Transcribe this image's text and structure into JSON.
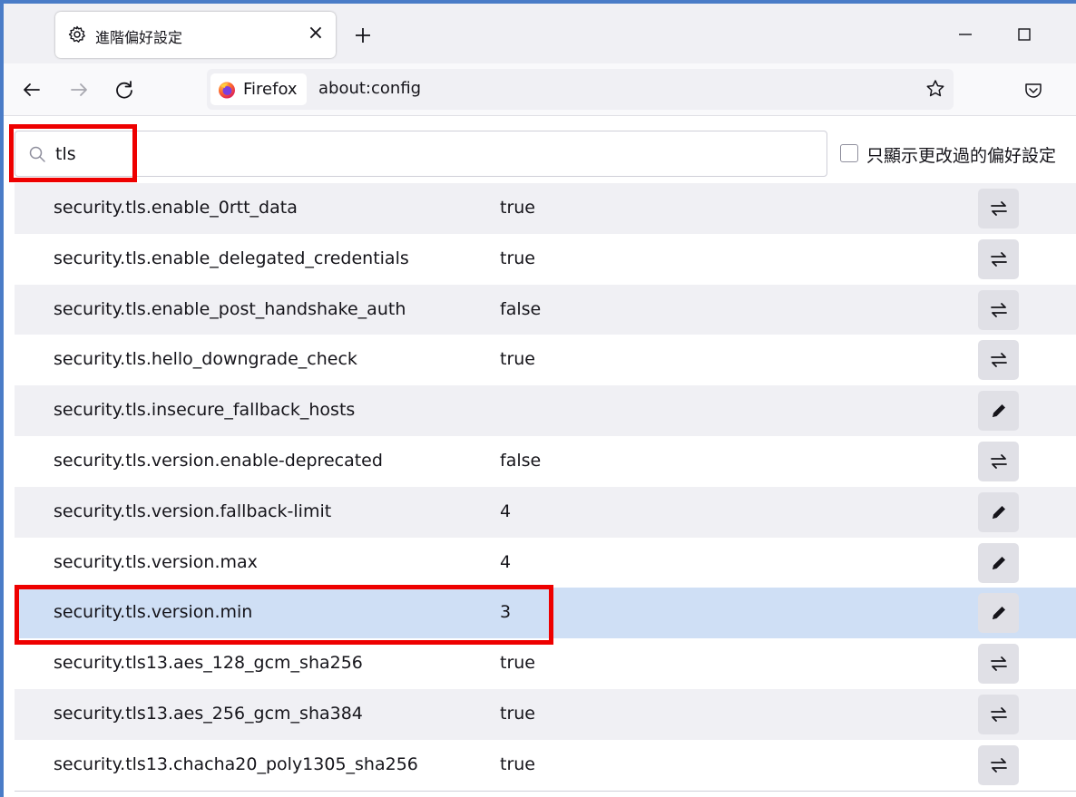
{
  "tab": {
    "title": "進階偏好設定",
    "close_label": "×"
  },
  "urlbar": {
    "identity_label": "Firefox",
    "url": "about:config"
  },
  "search": {
    "value": "tls"
  },
  "filter": {
    "modified_only_label": "只顯示更改過的偏好設定"
  },
  "prefs": [
    {
      "name": "security.tls.enable_0rtt_data",
      "value": "true",
      "action": "toggle"
    },
    {
      "name": "security.tls.enable_delegated_credentials",
      "value": "true",
      "action": "toggle"
    },
    {
      "name": "security.tls.enable_post_handshake_auth",
      "value": "false",
      "action": "toggle"
    },
    {
      "name": "security.tls.hello_downgrade_check",
      "value": "true",
      "action": "toggle"
    },
    {
      "name": "security.tls.insecure_fallback_hosts",
      "value": "",
      "action": "edit"
    },
    {
      "name": "security.tls.version.enable-deprecated",
      "value": "false",
      "action": "toggle"
    },
    {
      "name": "security.tls.version.fallback-limit",
      "value": "4",
      "action": "edit"
    },
    {
      "name": "security.tls.version.max",
      "value": "4",
      "action": "edit"
    },
    {
      "name": "security.tls.version.min",
      "value": "3",
      "action": "edit",
      "selected": true
    },
    {
      "name": "security.tls13.aes_128_gcm_sha256",
      "value": "true",
      "action": "toggle"
    },
    {
      "name": "security.tls13.aes_256_gcm_sha384",
      "value": "true",
      "action": "toggle"
    },
    {
      "name": "security.tls13.chacha20_poly1305_sha256",
      "value": "true",
      "action": "toggle"
    }
  ],
  "icons": {
    "toggle": "toggle-arrows-icon",
    "edit": "pencil-icon"
  },
  "colors": {
    "highlight_box": "#ee0000",
    "selected_row": "#cfdff5",
    "alt_row": "#f0f0f4",
    "window_border": "#4a7cc7"
  }
}
